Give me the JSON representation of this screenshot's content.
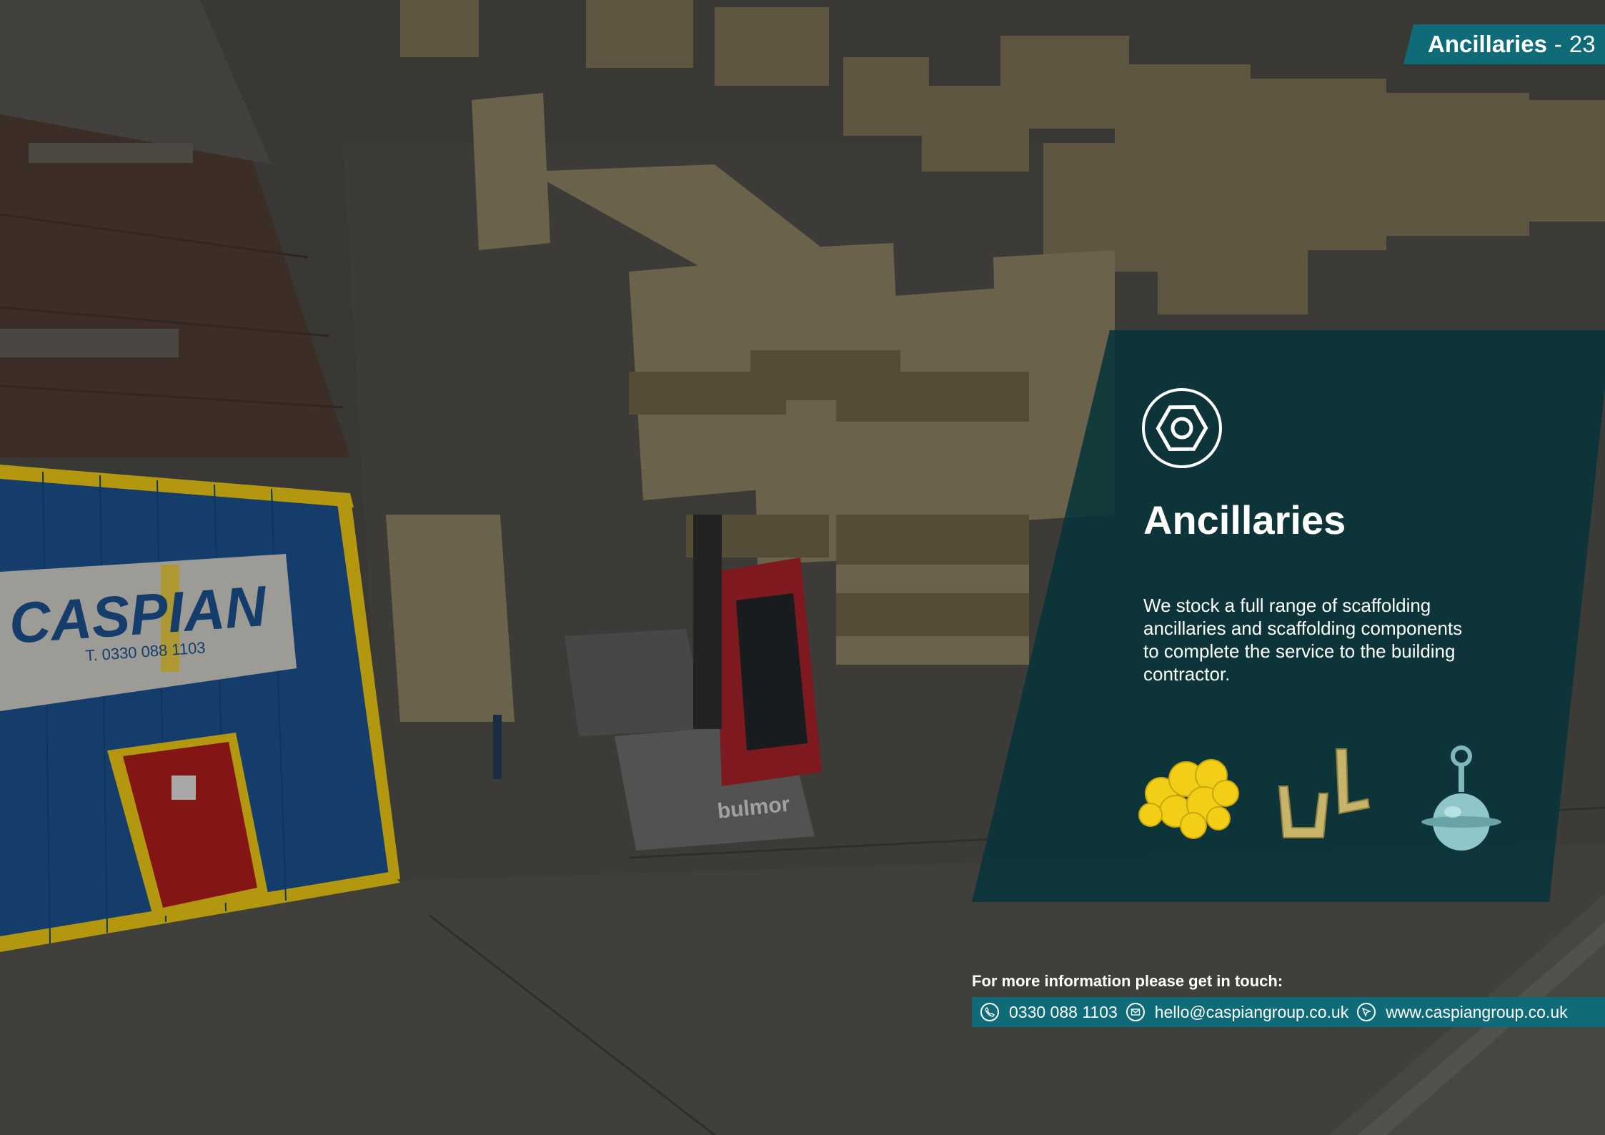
{
  "header": {
    "section": "Ancillaries",
    "separator": "-",
    "page_number": "23"
  },
  "yard_sign": {
    "brand": "CASPIAN",
    "phone": "T. 0330 088 1103"
  },
  "forklift_brand": "bulmor",
  "panel": {
    "icon": "hex-nut-icon",
    "title": "Ancillaries",
    "body": "We stock a full range of scaffolding ancillaries and scaffolding components to complete the service to the building contractor.",
    "products": [
      "yellow-scaffold-caps",
      "toe-board-clips",
      "scaffold-tie-ring"
    ]
  },
  "contact": {
    "heading": "For more information please get in touch:",
    "phone": "0330 088 1103",
    "email": "hello@caspiangroup.co.uk",
    "website": "www.caspiangroup.co.uk"
  },
  "colors": {
    "accent": "#0f6b77",
    "panel": "#06343a",
    "sign_blue": "#1a4f8a",
    "sign_yellow": "#e6c214",
    "door_red": "#a81c1c"
  }
}
